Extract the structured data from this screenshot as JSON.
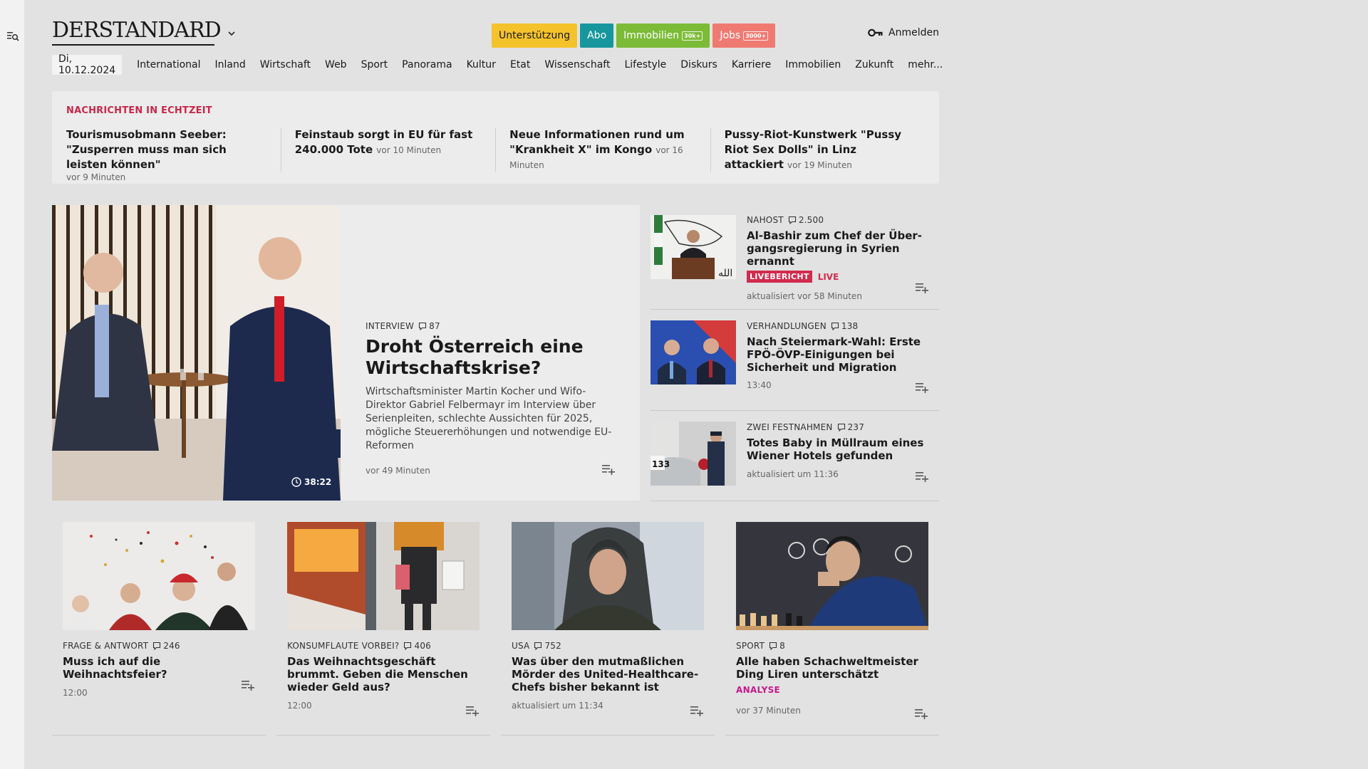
{
  "header": {
    "logo": "DERSTANDARD",
    "pills": [
      {
        "label": "Unterstützung",
        "badge": "",
        "bg": "#f4c22b",
        "fg": "#1a1a1a"
      },
      {
        "label": "Abo",
        "badge": "",
        "bg": "#17979d",
        "fg": "#ffffff"
      },
      {
        "label": "Immobilien",
        "badge": "30k+",
        "bg": "#7cbb38",
        "fg": "#ffffff"
      },
      {
        "label": "Jobs",
        "badge": "3000+",
        "bg": "#ef7a72",
        "fg": "#ffffff"
      }
    ],
    "login": "Anmelden"
  },
  "nav": {
    "date": "Di, 10.12.2024",
    "links": [
      "International",
      "Inland",
      "Wirtschaft",
      "Web",
      "Sport",
      "Panorama",
      "Kultur",
      "Etat",
      "Wissenschaft",
      "Lifestyle",
      "Diskurs",
      "Karriere",
      "Immobilien",
      "Zukunft",
      "mehr..."
    ]
  },
  "ticker": {
    "label": "NACHRICHTEN IN ECHTZEIT",
    "items": [
      {
        "title": "Tourismusobmann Seeber: \"Zusperren muss man sich leisten können\"",
        "time": "vor 9 Minuten"
      },
      {
        "title": "Feinstaub sorgt in EU für fast 240.000 Tote",
        "time": "vor 10 Minuten"
      },
      {
        "title": "Neue Informationen rund um \"Krank­heit X\" im Kongo",
        "time": "vor 16 Minuten"
      },
      {
        "title": "Pussy-Riot-Kunstwerk \"Pussy Riot Sex Dolls\" in Linz attackiert",
        "time": "vor 19 Minuten"
      }
    ]
  },
  "lead": {
    "kicker": "INTERVIEW",
    "comments": "87",
    "title": "Droht Österreich eine Wirt­schaftskrise?",
    "desc": "Wirtschaftsminister Martin Kocher und Wifo-Direktor Gabriel Felbermayr im Interview über Serienpleiten, schlechte Aussichten für 2025, mögliche Steuererhöhungen und notwendige EU-Reformen",
    "time": "vor 49 Minuten",
    "video_duration": "38:22"
  },
  "side": [
    {
      "kicker": "NAHOST",
      "comments": "2.500",
      "title": "Al-Bashir zum Chef der Über­gangsregierung in Syrien ernannt",
      "live_badge": "LIVEBERICHT",
      "live_text": "LIVE",
      "time": "aktualisiert vor 58 Minuten"
    },
    {
      "kicker": "VERHANDLUNGEN",
      "comments": "138",
      "title": "Nach Steiermark-Wahl: Erste FPÖ-ÖVP-Einigungen bei Sicherheit und Migration",
      "time": "13:40"
    },
    {
      "kicker": "ZWEI FESTNAHMEN",
      "comments": "237",
      "title": "Totes Baby in Müllraum eines Wiener Hotels gefunden",
      "time": "aktualisiert um 11:36"
    }
  ],
  "cards": [
    {
      "kicker": "FRAGE & ANTWORT",
      "comments": "246",
      "title": "Muss ich auf die Weihnachtsfeier?",
      "time": "12:00",
      "tag": ""
    },
    {
      "kicker": "KONSUMFLAUTE VORBEI?",
      "comments": "406",
      "title": "Das Weihnachtsgeschäft brummt. Geben die Menschen wieder Geld aus?",
      "time": "12:00",
      "tag": ""
    },
    {
      "kicker": "USA",
      "comments": "752",
      "title": "Was über den mutmaßlichen Mörder des United-Healthcare-Chefs bisher bekannt ist",
      "time": "aktualisiert um 11:34",
      "tag": ""
    },
    {
      "kicker": "SPORT",
      "comments": "8",
      "title": "Alle haben Schachweltmeister Ding Liren unterschätzt",
      "time": "vor 37 Minuten",
      "tag": "ANALYSE"
    }
  ]
}
